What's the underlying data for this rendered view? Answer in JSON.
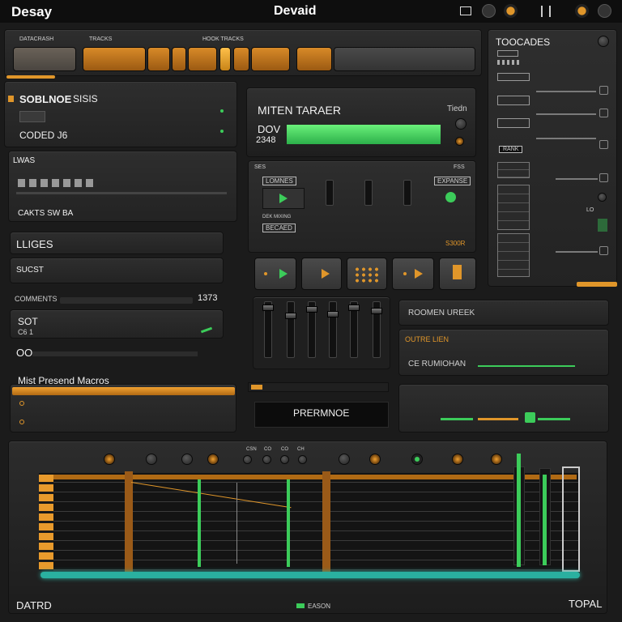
{
  "titlebar": {
    "app_name": "Desay",
    "center_title": "Devaid",
    "icons": [
      "window-icon",
      "moon-icon",
      "record-icon",
      "menu-icon",
      "power-icon",
      "settings-icon"
    ]
  },
  "top_tabs": [
    "DATACRASH",
    "TRACKS",
    "HOOK TRACKS"
  ],
  "left": {
    "section1_title": "SOBLNOE",
    "section1_value": "SISIS",
    "section1_sub": "CODED J6",
    "list_title": "LWAS",
    "list_sub": "CAKTS SW BA",
    "liges_label": "LLIGES",
    "sucst_label": "SUCST",
    "comments_label": "COMMENTS",
    "comments_value": "1373",
    "sot_label": "SOT",
    "sot_sub": "C6 1",
    "oo_label": "OO",
    "preset_title": "Mist Presend Macros"
  },
  "center": {
    "display_title": "MITEN TARAER",
    "display_side": "Tiedn",
    "display_value_a": "DOV",
    "display_value_b": "2348",
    "mixer_label": "SES",
    "mixer_side_label": "FSS",
    "mixer_btn1": "LOMNES",
    "mixer_btn2": "BECAED",
    "mixer_small": "DEK MIXING",
    "mixer_btn3": "EXPANSE",
    "mixer_code": "S300R",
    "preview_label": "PRERMNOE"
  },
  "right_lower": {
    "row1": "ROOMEN UREEK",
    "row2": "OUTRE LIEN",
    "row3": "CE RUMIOHAN"
  },
  "right_panel": {
    "title": "TOOCADES",
    "chip": "RANK",
    "level_label": "LO",
    "accent_color": "#e0962a"
  },
  "timeline": {
    "top_labels": [
      "CSN",
      "CO",
      "CO",
      "CH"
    ],
    "bottom_left": "DATRD",
    "bottom_center": "EASON",
    "bottom_right": "TOPAL"
  }
}
